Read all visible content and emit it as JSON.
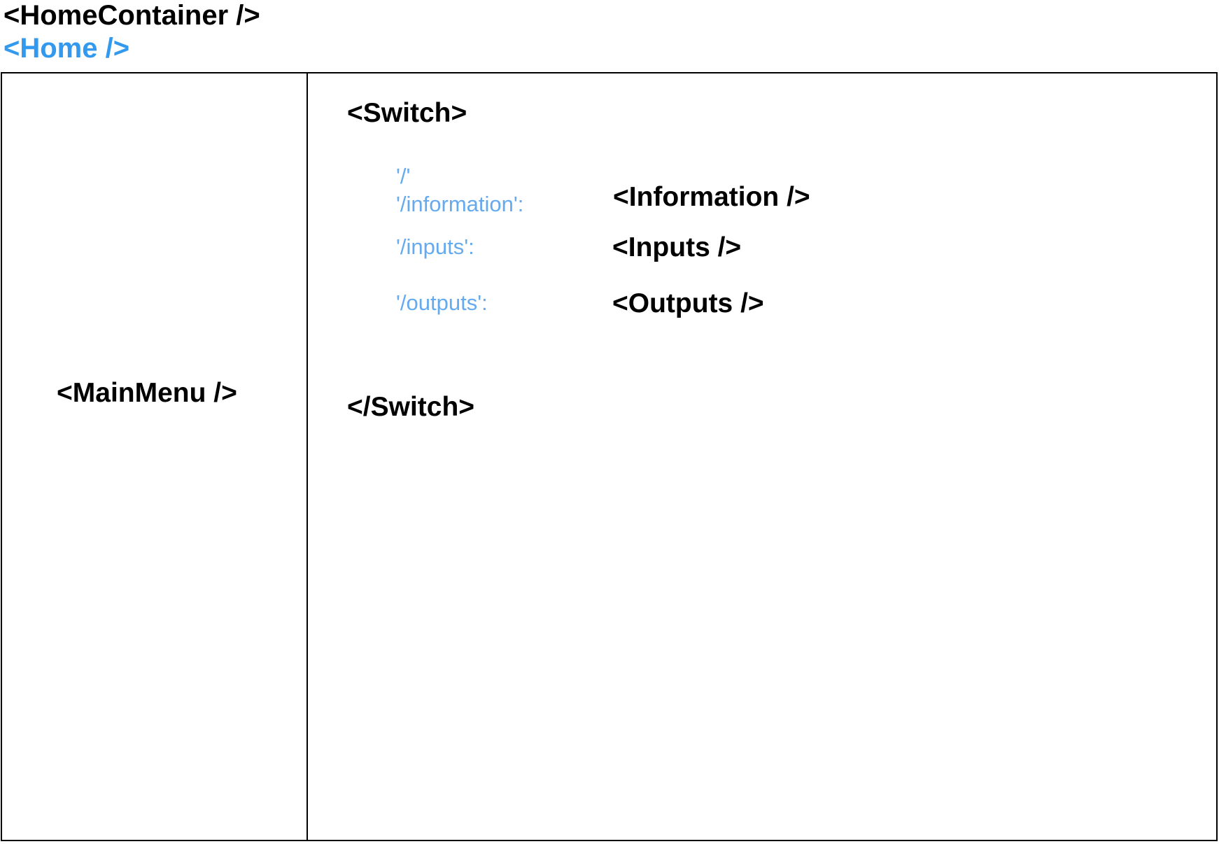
{
  "header": {
    "container_label": "<HomeContainer />",
    "home_label": "<Home />"
  },
  "sidebar": {
    "menu_label": "<MainMenu />"
  },
  "switch": {
    "open_tag": "<Switch>",
    "close_tag": "</Switch>",
    "routes": [
      {
        "paths": [
          "'/'",
          "'/information':"
        ],
        "component": "<Information />"
      },
      {
        "paths": [
          "'/inputs':"
        ],
        "component": "<Inputs />"
      },
      {
        "paths": [
          "'/outputs':"
        ],
        "component": "<Outputs />"
      }
    ]
  },
  "colors": {
    "home_label": "#3399ee",
    "route_path": "#66aaee",
    "text": "#000000",
    "border": "#000000"
  }
}
